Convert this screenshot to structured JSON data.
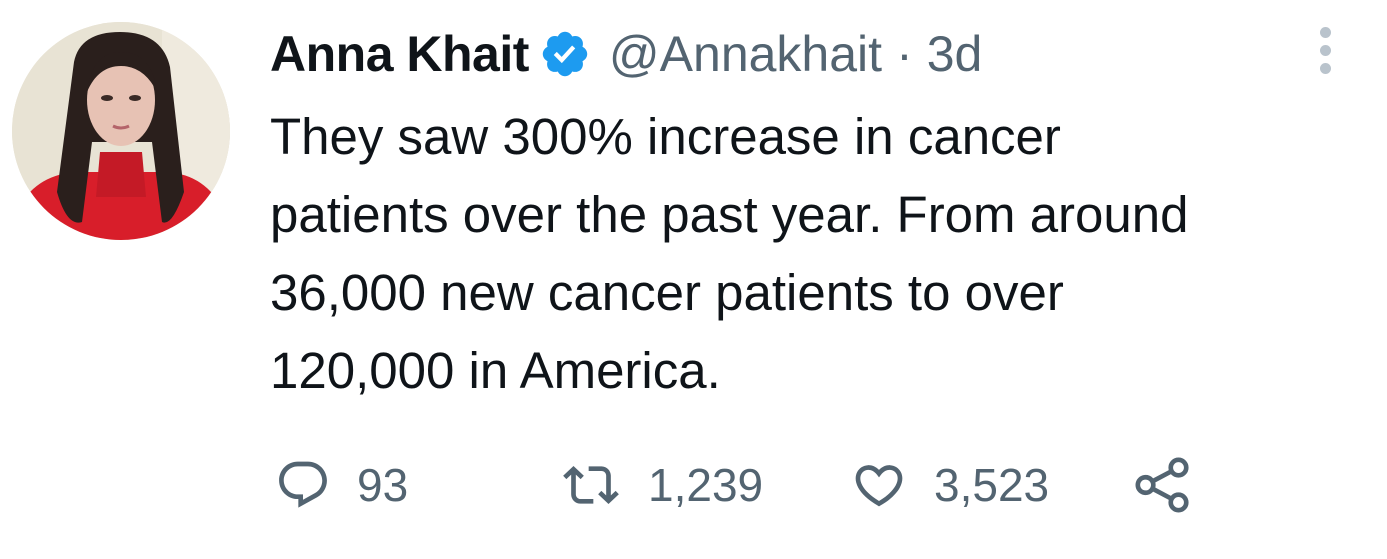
{
  "tweet": {
    "author_name": "Anna Khait",
    "handle": "@Annakhait",
    "separator": "·",
    "time": "3d",
    "text_lines": [
      "They saw 300% increase in cancer",
      "patients over the past year. From around",
      "36,000 new cancer patients to over",
      "120,000 in America."
    ]
  },
  "actions": {
    "replies": "93",
    "retweets": "1,239",
    "likes": "3,523"
  },
  "icons": {
    "verified": "verified-badge-icon",
    "more": "more-options-icon",
    "reply": "reply-icon",
    "retweet": "retweet-icon",
    "like": "heart-icon",
    "share": "share-icon"
  },
  "colors": {
    "text": "#0f1419",
    "secondary": "#536471",
    "verified_blue": "#1d9bf0"
  }
}
